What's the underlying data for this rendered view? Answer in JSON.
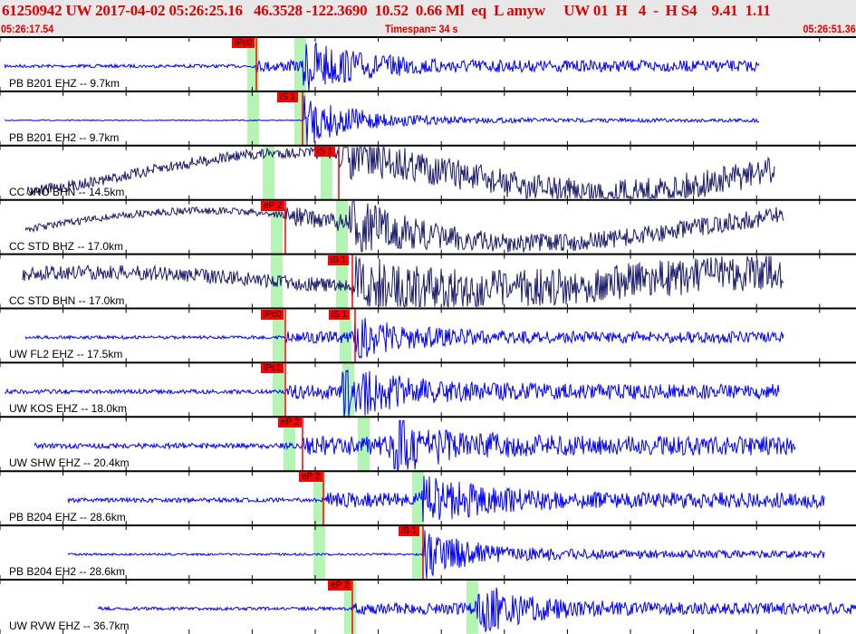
{
  "header": {
    "title": "61250942 UW 2017-04-02 05:26:25.16   46.3528 -122.3690  10.52  0.66 Ml  eq  L amyw     UW 01  H   4  -  H S4    9.41  1.11",
    "start_time": "05:26:17.54",
    "timespan": "Timespan=  34 s",
    "end_time": "05:26:51.36"
  },
  "colors": {
    "header_text": "#e00000",
    "trace_blue": "#0000ff",
    "trace_navy": "#1c1c6e",
    "pick": "#ff0000",
    "window": "#b4f5b4"
  },
  "channels": [
    {
      "label": "PB B201 EHZ -- 9.7km",
      "picks": [
        "iPc0"
      ]
    },
    {
      "label": "PB B201 EH2 -- 9.7km",
      "picks": [
        "iS 1"
      ]
    },
    {
      "label": "CC JRO BHN -- 14.5km",
      "picks": [
        "iS 1"
      ]
    },
    {
      "label": "CC STD BHZ -- 17.0km",
      "picks": [
        "eP 2"
      ]
    },
    {
      "label": "CC STD BHN -- 17.0km",
      "picks": [
        "iS 1"
      ]
    },
    {
      "label": "UW FL2 EHZ -- 17.5km",
      "picks": [
        "iPc0",
        "iS 1"
      ]
    },
    {
      "label": "UW KOS EHZ -- 18.0km",
      "picks": [
        "iPc1"
      ]
    },
    {
      "label": "UW SHW EHZ -- 20.4km",
      "picks": [
        "eP 2"
      ]
    },
    {
      "label": "PB B204 EHZ -- 28.6km",
      "picks": [
        "eP 2"
      ]
    },
    {
      "label": "PB B204 EH2 -- 28.6km",
      "picks": [
        "iS 1"
      ]
    },
    {
      "label": "UW RVW EHZ -- 36.7km",
      "picks": [
        "eP 2"
      ]
    }
  ]
}
